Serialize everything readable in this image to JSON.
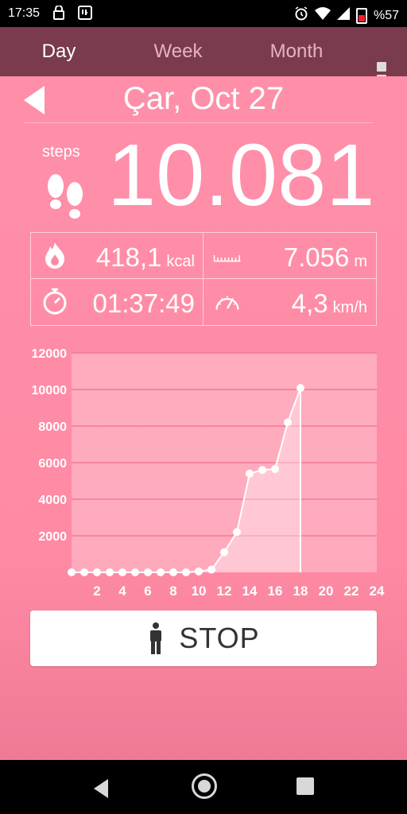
{
  "status_bar": {
    "time": "17:35",
    "battery": "%57"
  },
  "tabs": [
    {
      "label": "Day",
      "active": true
    },
    {
      "label": "Week",
      "active": false
    },
    {
      "label": "Month",
      "active": false
    }
  ],
  "header": {
    "date": "Çar, Oct 27"
  },
  "steps": {
    "label": "steps",
    "value": "10.081"
  },
  "stats": {
    "calories": {
      "value": "418,1",
      "unit": "kcal"
    },
    "distance": {
      "value": "7.056",
      "unit": "m"
    },
    "duration": {
      "value": "01:37:49"
    },
    "speed": {
      "value": "4,3",
      "unit": "km/h"
    }
  },
  "chart_data": {
    "type": "area",
    "x": [
      0,
      1,
      2,
      3,
      4,
      5,
      6,
      7,
      8,
      9,
      10,
      11,
      12,
      13,
      14,
      15,
      16,
      17,
      18
    ],
    "y": [
      0,
      0,
      0,
      0,
      0,
      0,
      0,
      0,
      0,
      0,
      50,
      150,
      1100,
      2200,
      5400,
      5600,
      5650,
      8200,
      10081
    ],
    "xticks": [
      2,
      4,
      6,
      8,
      10,
      12,
      14,
      16,
      18,
      20,
      22,
      24
    ],
    "yticks": [
      2000,
      4000,
      6000,
      8000,
      10000,
      12000
    ],
    "xlim": [
      0,
      24
    ],
    "ylim": [
      0,
      12000
    ]
  },
  "stop_button": {
    "label": "STOP"
  }
}
